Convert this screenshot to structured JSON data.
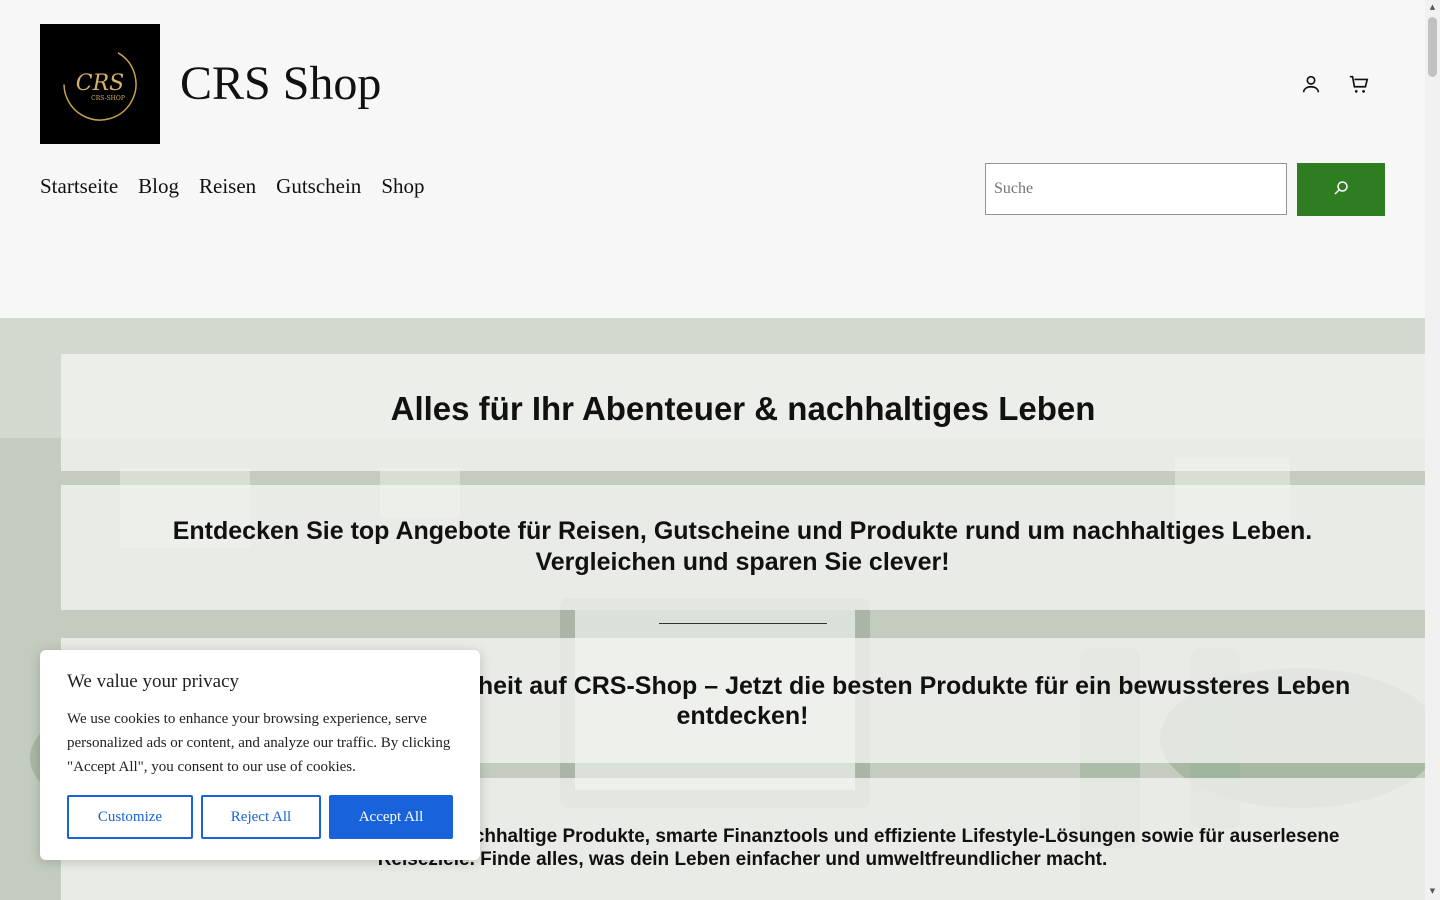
{
  "header": {
    "logo_text": "CRS",
    "logo_subtext": "CRS-SHOP",
    "site_title": "CRS Shop",
    "icons": [
      "account-icon",
      "cart-icon"
    ]
  },
  "nav": {
    "items": [
      "Startseite",
      "Blog",
      "Reisen",
      "Gutschein",
      "Shop"
    ]
  },
  "search": {
    "placeholder": "Suche",
    "button_icon": "search-icon",
    "button_color": "#2f7d21"
  },
  "hero": {
    "title": "Alles für Ihr Abenteuer & nachhaltiges Leben",
    "subtitle": "Entdecken Sie top Angebote für Reisen, Gutscheine und Produkte rund um nachhaltiges Leben. Vergleichen und sparen Sie clever!",
    "headline2": "Nachhaltigkeit & digitale Freiheit auf CRS-Shop – Jetzt die besten Produkte für ein bewussteres Leben entdecken!",
    "paragraph": "Hier findest du Empfehlungen für nachhaltige Produkte, smarte Finanztools und effiziente Lifestyle-Lösungen sowie für auserlesene Reiseziele. Finde alles, was dein Leben einfacher und umweltfreundlicher macht."
  },
  "cookie": {
    "title": "We value your privacy",
    "body": "We use cookies to enhance your browsing experience, serve personalized ads or content, and analyze our traffic. By clicking \"Accept All\", you consent to our use of cookies.",
    "customize": "Customize",
    "reject": "Reject All",
    "accept": "Accept All",
    "accent_color": "#1863dc"
  }
}
